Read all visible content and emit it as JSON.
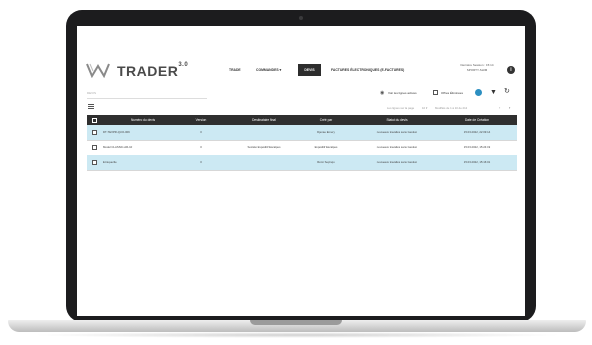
{
  "brand": {
    "name": "TRADER",
    "version": "3.0"
  },
  "nav": {
    "items": [
      {
        "label": "TRADE"
      },
      {
        "label": "COMMANDES ▾"
      },
      {
        "label": "DEVIS"
      },
      {
        "label": "FACTURES ÉLECTRONIQUES (E-FACTURES)"
      }
    ],
    "active_index": 2
  },
  "user": {
    "line1": "Dernière Session : 15:14",
    "line2": "SPORTY-SHIM"
  },
  "toolbar": {
    "search_placeholder": "DEVIS",
    "show_actions_label": "Voir les lignes actives",
    "removed_offers_label": "Offres Éliminées"
  },
  "pagination": {
    "rows_per_page_label": "Lus lignes sur la page",
    "rows_per_page_value": "10 ▾",
    "range_label": "Modifiés de 1 à 10 de 212",
    "prev": "‹",
    "next": "›"
  },
  "table": {
    "columns": [
      "Numéro du devis",
      "Version",
      "Destinataire final",
      "Créé par",
      "Statut du devis",
      "Date de Création"
    ],
    "rows": [
      {
        "number": "DT-TEXPR-QUO-009",
        "version": "0",
        "final": "",
        "created_by": "Djenèe Emery",
        "status": "nouveaux travailés sans Gestion",
        "date": "15.03.2022, 22:09:14"
      },
      {
        "number": "Model CLASSIC-AR-10",
        "version": "0",
        "final": "Société Expéditif Escalpes",
        "created_by": "Expéditif Escalpes",
        "status": "nouveaux travailés sans Gestion",
        "date": "15.03.2022, 15:24:19"
      },
      {
        "number": "Erréquerile",
        "version": "0",
        "final": "",
        "created_by": "Rémi Seçinqu",
        "status": "nouveaux travailés sans Gestion",
        "date": "15.03.2022, 15:16:01"
      }
    ]
  },
  "colors": {
    "header_bg": "#2f2f2f",
    "row_highlight": "#cce9f3",
    "accent": "#2c8fc1"
  }
}
